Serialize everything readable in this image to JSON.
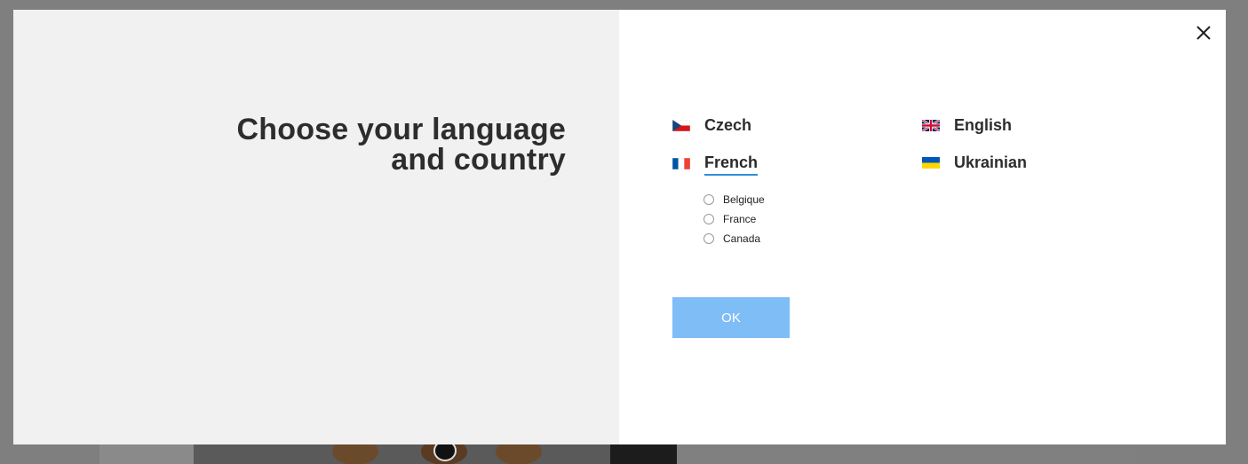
{
  "modal": {
    "title": "Choose your language\nand country",
    "close_icon": "close-icon",
    "languages": [
      {
        "label": "Czech",
        "flag": "cz-flag-icon",
        "active": false
      },
      {
        "label": "English",
        "flag": "gb-flag-icon",
        "active": false
      },
      {
        "label": "French",
        "flag": "fr-flag-icon",
        "active": true
      },
      {
        "label": "Ukrainian",
        "flag": "ua-flag-icon",
        "active": false
      }
    ],
    "countries": [
      {
        "label": "Belgique",
        "selected": false
      },
      {
        "label": "France",
        "selected": false
      },
      {
        "label": "Canada",
        "selected": false
      }
    ],
    "ok_label": "OK"
  },
  "colors": {
    "accent_underline": "#2f8fd6",
    "ok_button": "#7fbdf7",
    "left_panel": "#f1f1f1",
    "overlay": "#7f7f7f"
  }
}
